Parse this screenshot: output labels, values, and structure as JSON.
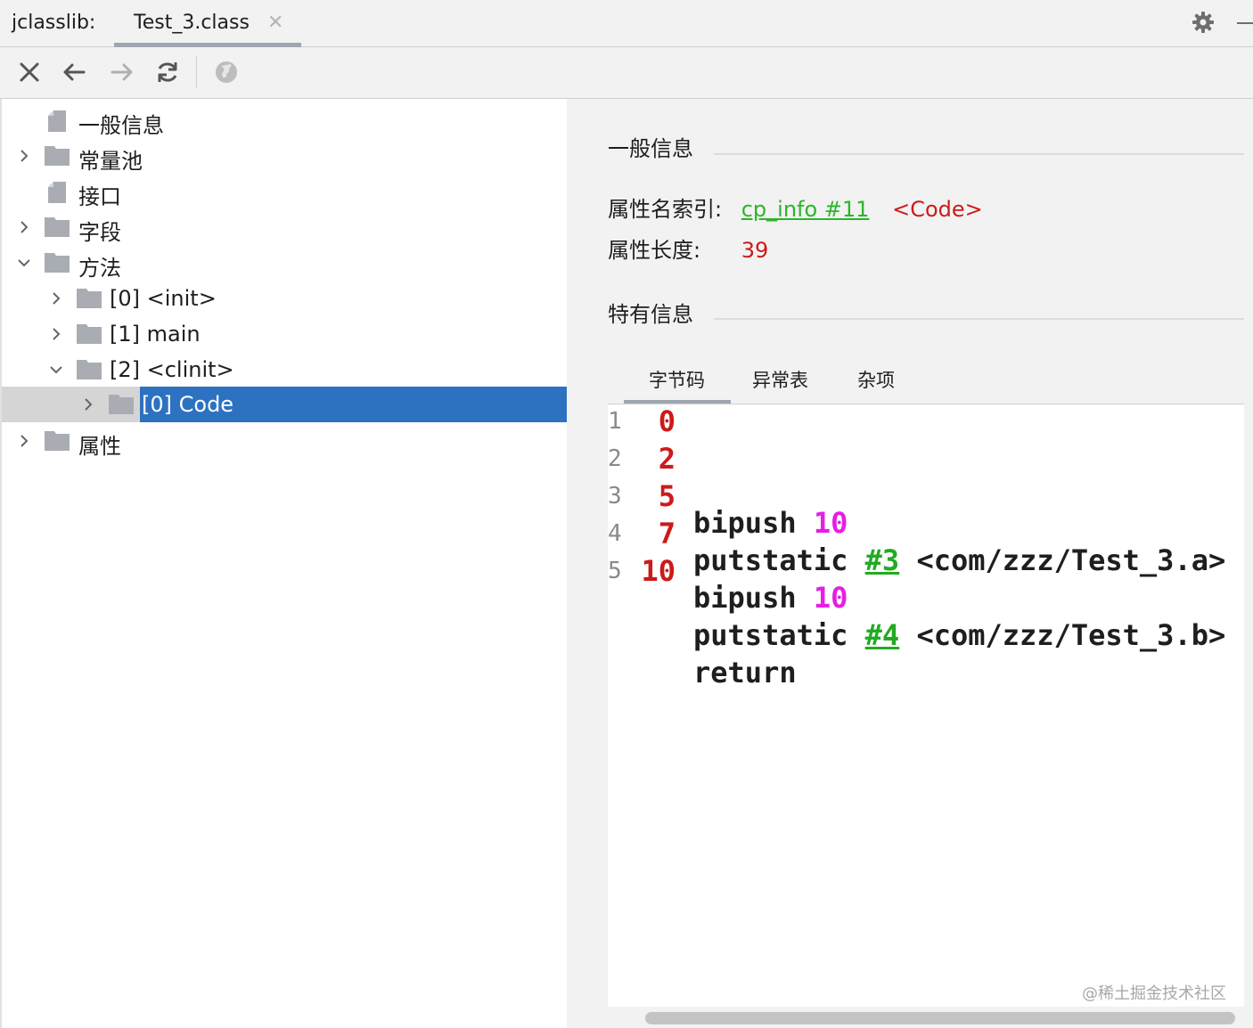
{
  "header": {
    "app_title": "jclasslib:",
    "tab_label": "Test_3.class",
    "tab_close": "✕"
  },
  "toolbar": {
    "buttons": [
      "close-icon",
      "back-arrow-icon",
      "forward-arrow-icon",
      "refresh-icon",
      "globe-icon"
    ]
  },
  "tree": {
    "items": [
      {
        "label": "一般信息"
      },
      {
        "label": "常量池"
      },
      {
        "label": "接口"
      },
      {
        "label": "字段"
      },
      {
        "label": "方法"
      },
      {
        "label": "[0] <init>"
      },
      {
        "label": "[1] main"
      },
      {
        "label": "[2] <clinit>"
      },
      {
        "label": "[0] Code"
      },
      {
        "label": "属性"
      }
    ]
  },
  "detail": {
    "general_title": "一般信息",
    "attr_name_label": "属性名索引:",
    "attr_name_link": "cp_info #11",
    "attr_name_value": "<Code>",
    "attr_length_label": "属性长度:",
    "attr_length_value": "39",
    "specific_title": "特有信息",
    "subtabs": [
      "字节码",
      "异常表",
      "杂项"
    ],
    "code": [
      {
        "ln": "1",
        "off": "0",
        "op": "bipush",
        "arg": "10",
        "ref": "",
        "desc": ""
      },
      {
        "ln": "2",
        "off": "2",
        "op": "putstatic",
        "arg": "",
        "ref": "#3",
        "desc": "<com/zzz/Test_3.a>"
      },
      {
        "ln": "3",
        "off": "5",
        "op": "bipush",
        "arg": "10",
        "ref": "",
        "desc": ""
      },
      {
        "ln": "4",
        "off": "7",
        "op": "putstatic",
        "arg": "",
        "ref": "#4",
        "desc": "<com/zzz/Test_3.b>"
      },
      {
        "ln": "5",
        "off": "10",
        "op": "return",
        "arg": "",
        "ref": "",
        "desc": ""
      }
    ],
    "watermark": "@稀土掘金技术社区"
  },
  "colors": {
    "selection": "#2d72c0",
    "link_green": "#2bb52b",
    "value_red": "#cc1a1a",
    "number_magenta": "#e61ee6"
  }
}
